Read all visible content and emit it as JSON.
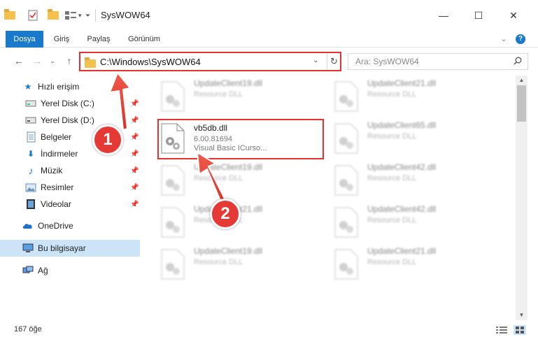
{
  "window": {
    "title": "SysWOW64",
    "minimize": "—",
    "maximize": "☐",
    "close": "✕"
  },
  "ribbon": {
    "tabs": [
      {
        "label": "Dosya",
        "active": true
      },
      {
        "label": "Giriş"
      },
      {
        "label": "Paylaş"
      },
      {
        "label": "Görünüm"
      }
    ],
    "expand": "⌄",
    "help": "?"
  },
  "address": {
    "path": "C:\\Windows\\SysWOW64",
    "dropdown": "⌄",
    "refresh": "↻"
  },
  "search": {
    "placeholder": "Ara: SysWOW64"
  },
  "nav": {
    "back": "←",
    "forward": "→",
    "recent": "⌄",
    "up": "↑",
    "items": [
      {
        "label": "Hızlı erişim",
        "icon": "star-icon"
      },
      {
        "label": "Yerel Disk (C:)",
        "icon": "drive-icon"
      },
      {
        "label": "Yerel Disk (D:)",
        "icon": "drive-icon"
      },
      {
        "label": "Belgeler",
        "icon": "documents-icon"
      },
      {
        "label": "İndirmeler",
        "icon": "download-icon"
      },
      {
        "label": "Müzik",
        "icon": "music-icon"
      },
      {
        "label": "Resimler",
        "icon": "pictures-icon"
      },
      {
        "label": "Videolar",
        "icon": "video-icon"
      },
      {
        "label": "OneDrive",
        "icon": "cloud-icon"
      },
      {
        "label": "Bu bilgisayar",
        "icon": "computer-icon"
      },
      {
        "label": "Ağ",
        "icon": "network-icon"
      }
    ]
  },
  "files": [
    {
      "name": "UpdateClient19.dll",
      "sub": "Resource DLL"
    },
    {
      "name": "UpdateClient21.dll",
      "sub": "Resource DLL"
    },
    {
      "name": "vb5db.dll",
      "version": "6.00.81694",
      "desc": "Visual Basic ICurso..."
    },
    {
      "name": "UpdateClient65.dll",
      "sub": "Resource DLL"
    },
    {
      "name": "UpdateClient19.dll",
      "sub": "Resource DLL"
    },
    {
      "name": "UpdateClient42.dll",
      "sub": "Resource DLL"
    },
    {
      "name": "UpdateClient21.dll",
      "sub": "Resource DLL"
    },
    {
      "name": "UpdateClient42.dll",
      "sub": "Resource DLL"
    },
    {
      "name": "UpdateClient19.dll",
      "sub": "Resource DLL"
    },
    {
      "name": "UpdateClient21.dll",
      "sub": "Resource DLL"
    }
  ],
  "status": {
    "count": "167 öğe"
  },
  "callouts": [
    "1",
    "2"
  ],
  "colors": {
    "accent": "#1979ca",
    "highlight": "#e8302e",
    "selection": "#cce4f7"
  }
}
